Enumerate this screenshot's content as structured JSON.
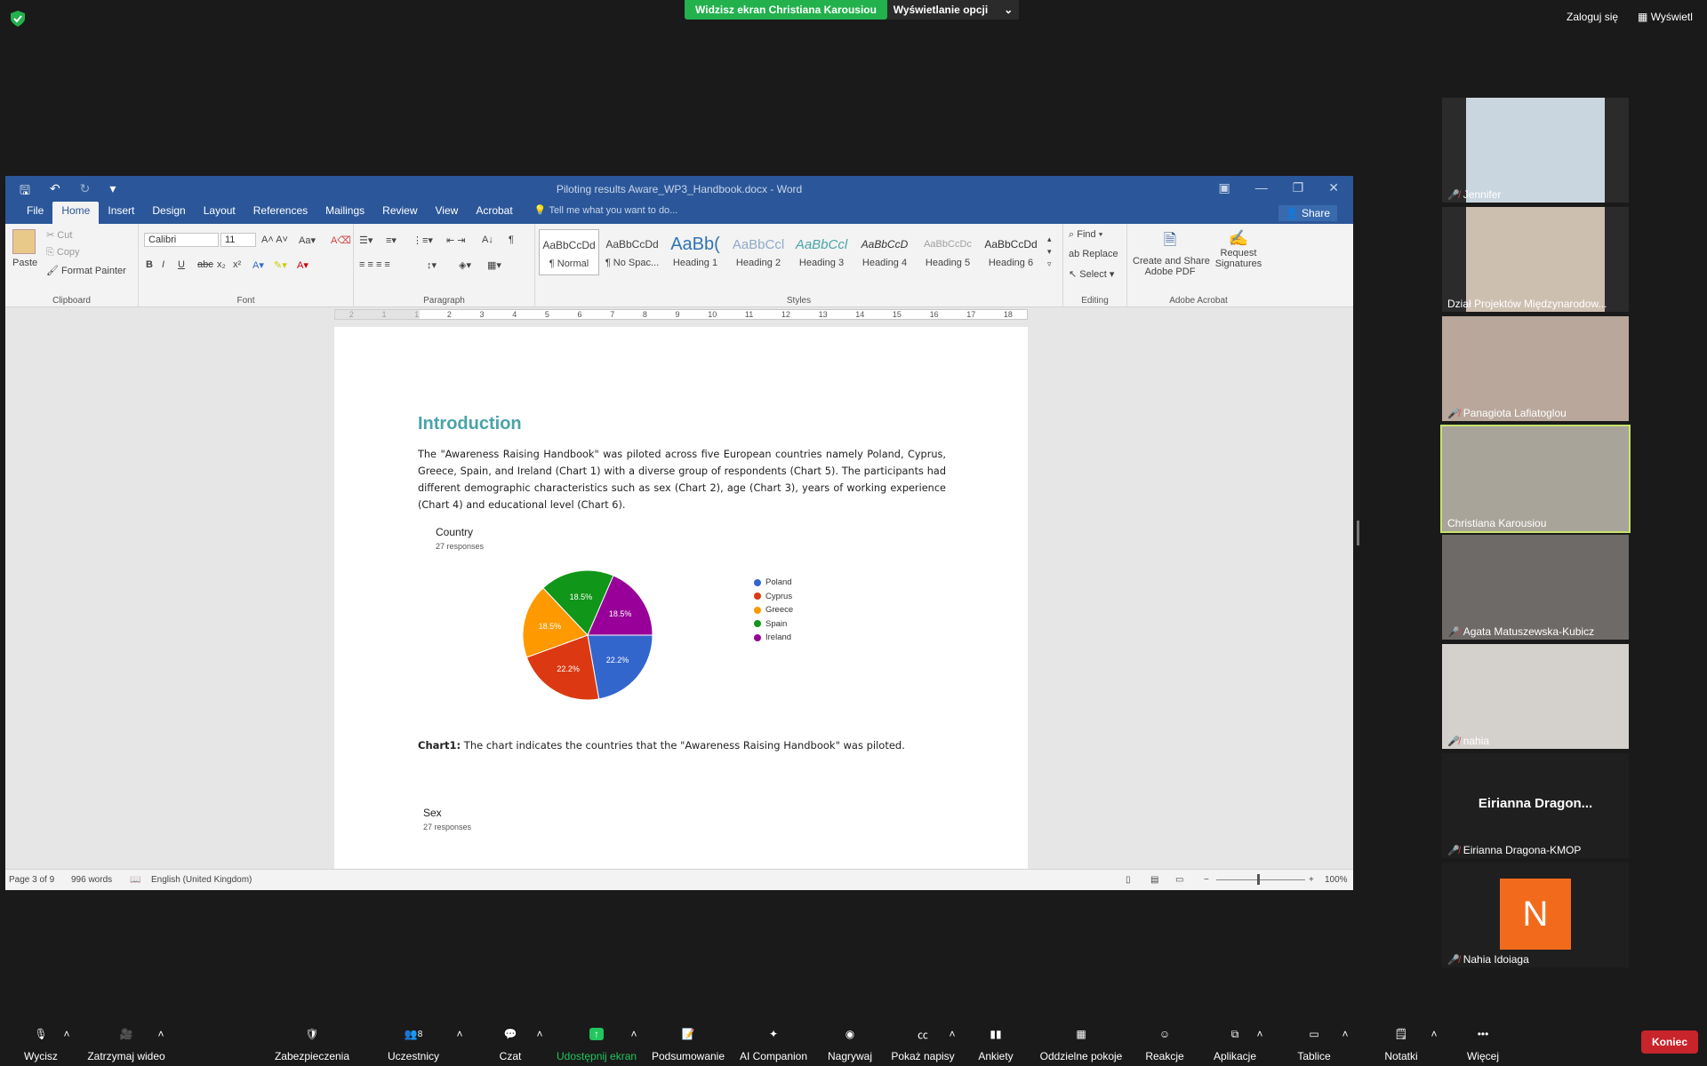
{
  "meeting": {
    "share_status": "Widzisz ekran Christiana Karousiou",
    "view_options": "Wyświetlanie opcji",
    "login": "Zaloguj się",
    "view": "Wyświetl"
  },
  "word": {
    "window_title": "Piloting results Aware_WP3_Handbook.docx - Word",
    "tabs": [
      "File",
      "Home",
      "Insert",
      "Design",
      "Layout",
      "References",
      "Mailings",
      "Review",
      "View",
      "Acrobat"
    ],
    "tell_me": "Tell me what you want to do...",
    "share": "Share",
    "clipboard": {
      "paste": "Paste",
      "cut": "Cut",
      "copy": "Copy",
      "format_painter": "Format Painter",
      "label": "Clipboard"
    },
    "font": {
      "name": "Calibri",
      "size": "11",
      "label": "Font"
    },
    "paragraph_label": "Paragraph",
    "styles": [
      {
        "preview": "AaBbCcDd",
        "name": "¶ Normal"
      },
      {
        "preview": "AaBbCcDd",
        "name": "¶ No Spac..."
      },
      {
        "preview": "AaBb(",
        "name": "Heading 1"
      },
      {
        "preview": "AaBbCcl",
        "name": "Heading 2"
      },
      {
        "preview": "AaBbCcl",
        "name": "Heading 3"
      },
      {
        "preview": "AaBbCcD",
        "name": "Heading 4"
      },
      {
        "preview": "AaBbCcDc",
        "name": "Heading 5"
      },
      {
        "preview": "AaBbCcDd",
        "name": "Heading 6"
      }
    ],
    "styles_label": "Styles",
    "editing": {
      "find": "Find",
      "replace": "Replace",
      "select": "Select",
      "label": "Editing"
    },
    "acrobat": {
      "create": "Create and Share",
      "create2": "Adobe PDF",
      "request": "Request",
      "request2": "Signatures",
      "label": "Adobe Acrobat"
    },
    "ruler_ticks": [
      "2",
      "1",
      "1",
      "2",
      "3",
      "4",
      "5",
      "6",
      "7",
      "8",
      "9",
      "10",
      "11",
      "12",
      "13",
      "14",
      "15",
      "16",
      "17",
      "18"
    ],
    "document": {
      "heading": "Introduction",
      "paragraph": "The \"Awareness Raising Handbook\" was piloted across five European countries namely Poland, Cyprus, Greece, Spain, and Ireland (Chart 1) with a diverse group of respondents (Chart 5). The participants had different demographic characteristics such as sex (Chart 2), age (Chart 3), years of working experience (Chart 4) and educational level (Chart 6).",
      "caption_bold": "Chart1:",
      "caption_text": " The chart indicates the countries that the \"Awareness Raising Handbook\" was piloted.",
      "sex_title": "Sex",
      "sex_sub": "27 responses"
    },
    "status": {
      "page": "Page 3 of 9",
      "words": "996 words",
      "language": "English (United Kingdom)",
      "zoom": "100%"
    }
  },
  "chart_data": {
    "type": "pie",
    "title": "Country",
    "subtitle": "27 responses",
    "categories": [
      "Poland",
      "Cyprus",
      "Greece",
      "Spain",
      "Ireland"
    ],
    "values": [
      22.2,
      22.2,
      18.5,
      18.5,
      18.5
    ],
    "labels": [
      "22.2%",
      "22.2%",
      "18.5%",
      "18.5%",
      "18.5%"
    ],
    "colors": [
      "#3366cc",
      "#dc3912",
      "#ff9900",
      "#109618",
      "#990099"
    ],
    "legend": "right"
  },
  "participants": [
    {
      "name": "Jennifer",
      "muted": true
    },
    {
      "name": "Dział Projektów Międzynarodow...",
      "muted": false
    },
    {
      "name": "Panagiota Lafiatoglou",
      "muted": true
    },
    {
      "name": "Christiana Karousiou",
      "muted": false
    },
    {
      "name": "Agata Matuszewska-Kubicz",
      "muted": true
    },
    {
      "name": "nahia",
      "muted": true
    },
    {
      "name": "Eirianna Dragona-KMOP",
      "muted": true,
      "display": "Eirianna  Dragon..."
    },
    {
      "name": "Nahia Idoiaga",
      "muted": true,
      "initial": "N"
    }
  ],
  "toolbar": [
    "Wycisz",
    "Zatrzymaj wideo",
    "Zabezpieczenia",
    "Uczestnicy",
    "Czat",
    "Udostępnij ekran",
    "Podsumowanie",
    "AI Companion",
    "Nagrywaj",
    "Pokaż napisy",
    "Ankiety",
    "Oddzielne pokoje",
    "Reakcje",
    "Aplikacje",
    "Tablice",
    "Notatki",
    "Więcej"
  ],
  "participants_count": "8",
  "end_label": "Koniec"
}
